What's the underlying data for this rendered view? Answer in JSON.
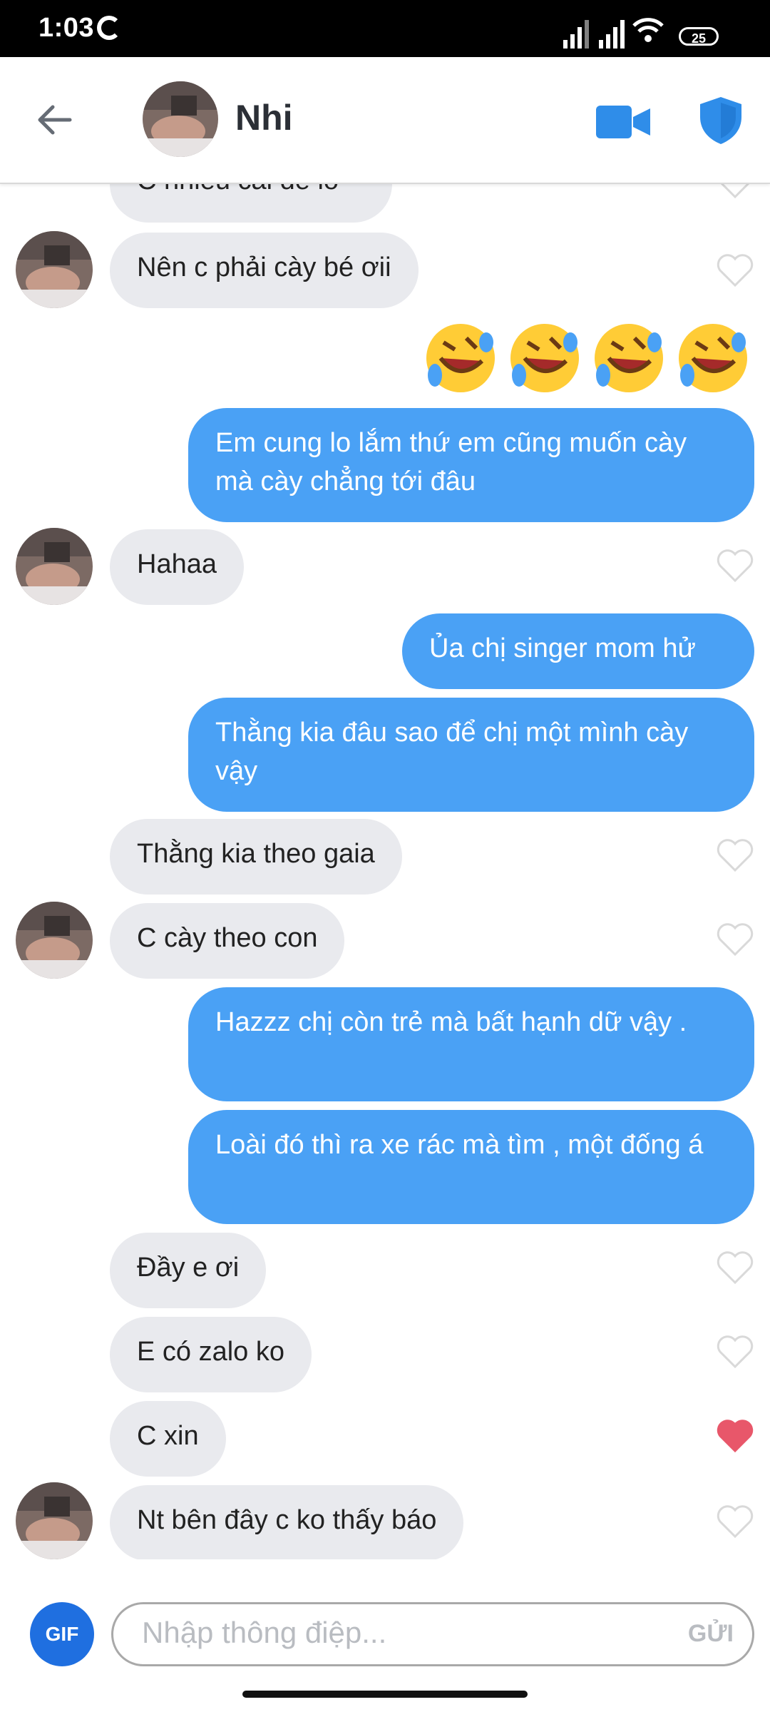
{
  "status_bar": {
    "time": "1:03",
    "battery": "25"
  },
  "header": {
    "back_icon": "arrow-left-icon",
    "name": "Nhi",
    "video_icon": "video-camera-icon",
    "shield_icon": "shield-icon"
  },
  "messages": {
    "m0": {
      "text": "C nhiều cái để lo",
      "side": "in"
    },
    "m1": {
      "text": "Nên c phải cày bé ơii",
      "side": "in"
    },
    "emojis": [
      "🤣",
      "🤣",
      "🤣",
      "🤣"
    ],
    "m2": {
      "text": "Em cung lo lắm thứ   em cũng muốn cày mà cày chẳng tới đâu",
      "side": "out"
    },
    "m3": {
      "text": "Hahaa",
      "side": "in"
    },
    "m4": {
      "text": "Ủa chị singer mom hử",
      "side": "out"
    },
    "m5": {
      "text": "Thằng kia đâu sao để chị một mình cày vậy",
      "side": "out"
    },
    "m6": {
      "text": "Thằng kia theo gaia",
      "side": "in"
    },
    "m7": {
      "text": "C cày theo con",
      "side": "in"
    },
    "m8": {
      "text": "Hazzz chị còn trẻ mà bất hạnh dữ vậy .",
      "side": "out"
    },
    "m9": {
      "text": "Loài đó thì ra xe rác mà tìm , một đống á",
      "side": "out"
    },
    "m10": {
      "text": "Đầy e ơi",
      "side": "in"
    },
    "m11": {
      "text": "E có zalo ko",
      "side": "in"
    },
    "m12": {
      "text": "C xin",
      "side": "in",
      "liked": true
    },
    "m13": {
      "text": "Nt bên đây c ko thấy báo",
      "side": "in"
    }
  },
  "composer": {
    "gif_label": "GIF",
    "placeholder": "Nhập thông điệp...",
    "send_label": "GỬI"
  },
  "colors": {
    "outgoing": "#4aa1f5",
    "incoming": "#e9eaee",
    "accent": "#1f6fe0",
    "like": "#e8576a"
  }
}
